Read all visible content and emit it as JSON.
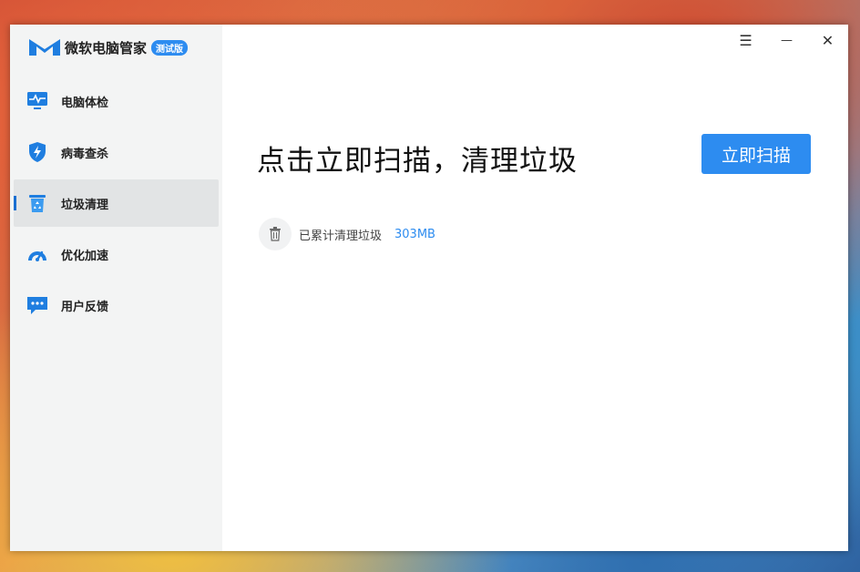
{
  "app": {
    "name": "微软电脑管家",
    "badge": "测试版",
    "accent_color": "#2d8cf0"
  },
  "sidebar": {
    "items": [
      {
        "label": "电脑体检",
        "icon": "monitor-pulse-icon",
        "active": false
      },
      {
        "label": "病毒查杀",
        "icon": "shield-bolt-icon",
        "active": false
      },
      {
        "label": "垃圾清理",
        "icon": "recycle-bin-icon",
        "active": true
      },
      {
        "label": "优化加速",
        "icon": "speedometer-icon",
        "active": false
      },
      {
        "label": "用户反馈",
        "icon": "chat-bubble-icon",
        "active": false
      }
    ]
  },
  "titlebar": {
    "menu": "☰",
    "minimize": "—",
    "close": "✕"
  },
  "main": {
    "headline": "点击立即扫描，清理垃圾",
    "scan_button": "立即扫描",
    "stats_label": "已累计清理垃圾",
    "stats_value": "303MB"
  }
}
